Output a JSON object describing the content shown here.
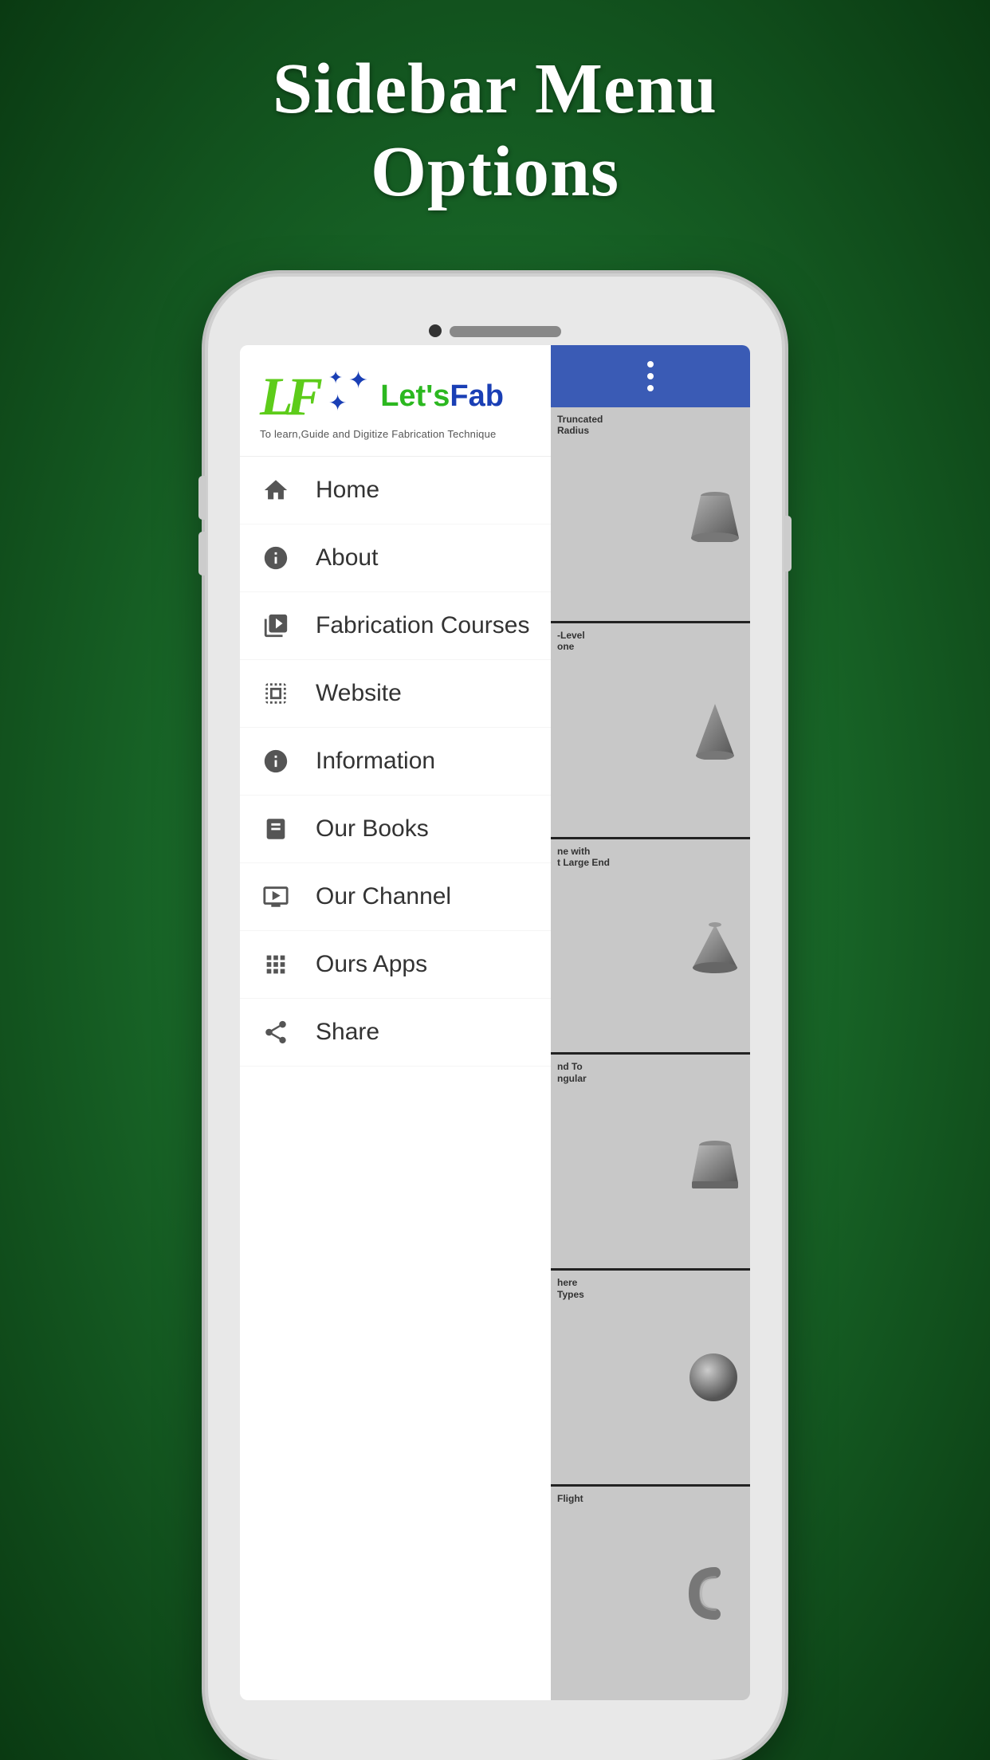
{
  "page": {
    "title_line1": "Sidebar Menu",
    "title_line2": "Options"
  },
  "logo": {
    "letters": "LF",
    "brand_name_prefix": "Let's",
    "brand_name_suffix": "Fab",
    "tagline": "To learn,Guide and Digitize Fabrication Technique"
  },
  "menu": {
    "items": [
      {
        "id": "home",
        "label": "Home",
        "icon": "home-icon"
      },
      {
        "id": "about",
        "label": "About",
        "icon": "info-icon"
      },
      {
        "id": "fabrication-courses",
        "label": "Fabrication Courses",
        "icon": "courses-icon"
      },
      {
        "id": "website",
        "label": "Website",
        "icon": "website-icon"
      },
      {
        "id": "information",
        "label": "Information",
        "icon": "info2-icon"
      },
      {
        "id": "our-books",
        "label": "Our Books",
        "icon": "books-icon"
      },
      {
        "id": "our-channel",
        "label": "Our Channel",
        "icon": "channel-icon"
      },
      {
        "id": "ours-apps",
        "label": "Ours Apps",
        "icon": "apps-icon"
      },
      {
        "id": "share",
        "label": "Share",
        "icon": "share-icon"
      }
    ]
  },
  "cards": [
    {
      "id": "card1",
      "label": "Truncated\nRadius"
    },
    {
      "id": "card2",
      "label": "-Level\none"
    },
    {
      "id": "card3",
      "label": "ne with\nt Large End"
    },
    {
      "id": "card4",
      "label": "nd To\nngular"
    },
    {
      "id": "card5",
      "label": "here\nTypes"
    },
    {
      "id": "card6",
      "label": "Flight"
    }
  ],
  "colors": {
    "bg_start": "#2d8a3e",
    "bg_end": "#0a3a12",
    "brand_blue": "#3a5bb5",
    "brand_green": "#5dcc1a",
    "title_color": "#ffffff"
  }
}
